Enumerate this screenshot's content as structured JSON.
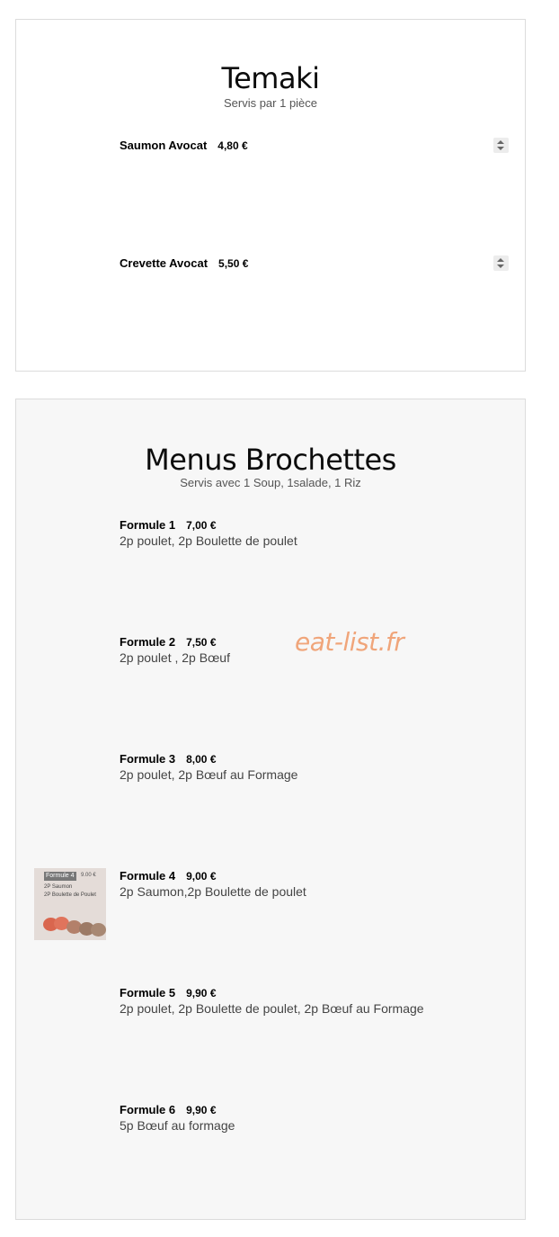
{
  "temaki": {
    "title": "Temaki",
    "subtitle": "Servis par 1 pièce",
    "items": [
      {
        "name": "Saumon Avocat",
        "price": "4,80 €"
      },
      {
        "name": "Crevette Avocat",
        "price": "5,50 €"
      }
    ]
  },
  "brochettes": {
    "title": "Menus Brochettes",
    "subtitle": "Servis avec 1 Soup, 1salade, 1 Riz",
    "items": [
      {
        "name": "Formule 1",
        "price": "7,00 €",
        "desc": "2p poulet, 2p Boulette de poulet"
      },
      {
        "name": "Formule 2",
        "price": "7,50 €",
        "desc": "2p poulet , 2p Bœuf"
      },
      {
        "name": "Formule 3",
        "price": "8,00 €",
        "desc": "2p poulet, 2p Bœuf au Formage"
      },
      {
        "name": "Formule 4",
        "price": "9,00 €",
        "desc": "2p Saumon,2p Boulette de poulet"
      },
      {
        "name": "Formule 5",
        "price": "9,90 €",
        "desc": "2p poulet, 2p Boulette de poulet, 2p Bœuf au Formage"
      },
      {
        "name": "Formule 6",
        "price": "9,90 €",
        "desc": "5p Bœuf au formage"
      }
    ],
    "thumbnail": {
      "title": "Formule 4",
      "price": "9.00 €",
      "line1": "2P Saumon",
      "line2": "2P Boulette de Poulet"
    }
  },
  "watermark": "eat-list.fr",
  "colors": {
    "watermark": "#f0a57a",
    "card_bg_alt": "#f7f7f7",
    "border": "#dcdcdc"
  },
  "icons": {
    "quantity_stepper": "up-down-arrows"
  }
}
